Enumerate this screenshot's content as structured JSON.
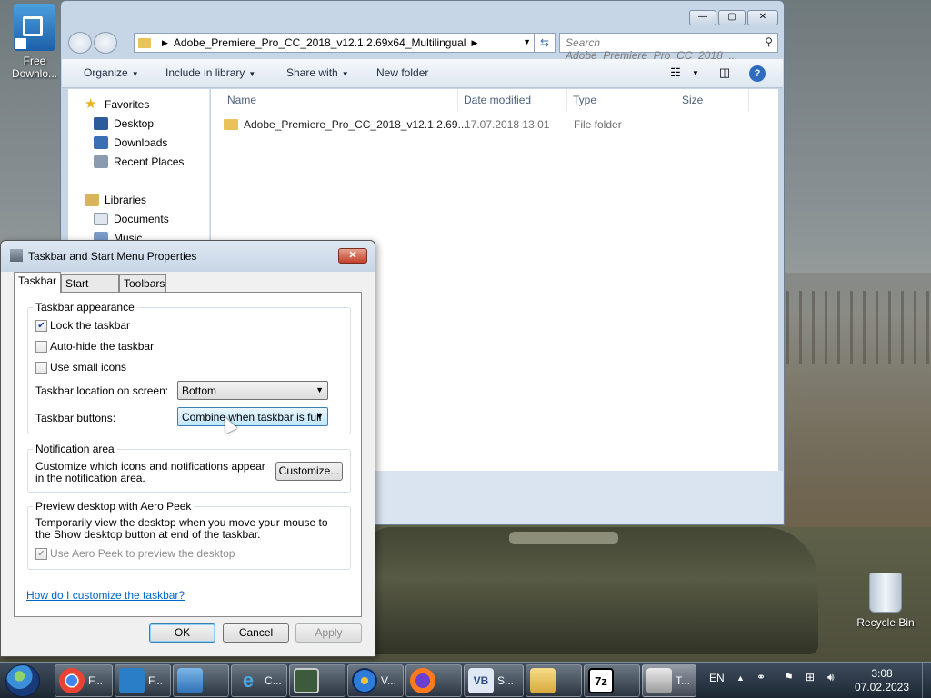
{
  "desktop": {
    "icons": [
      {
        "label": "Free Downlo..."
      },
      {
        "label": "Recycle Bin"
      }
    ]
  },
  "explorer": {
    "address_path": "Adobe_Premiere_Pro_CC_2018_v12.1.2.69x64_Multilingual",
    "search_placeholder": "Search Adobe_Premiere_Pro_CC_2018_...",
    "toolbar": {
      "organize": "Organize",
      "include_in_library": "Include in library",
      "share_with": "Share with",
      "new_folder": "New folder"
    },
    "nav": {
      "favorites": "Favorites",
      "desktop": "Desktop",
      "downloads": "Downloads",
      "recent_places": "Recent Places",
      "libraries": "Libraries",
      "documents": "Documents",
      "music": "Music"
    },
    "columns": {
      "name": "Name",
      "date_modified": "Date modified",
      "type": "Type",
      "size": "Size"
    },
    "files": [
      {
        "name": "Adobe_Premiere_Pro_CC_2018_v12.1.2.69...",
        "date": "17.07.2018 13:01",
        "type": "File folder"
      }
    ]
  },
  "dialog": {
    "title": "Taskbar and Start Menu Properties",
    "tabs": [
      "Taskbar",
      "Start Menu",
      "Toolbars"
    ],
    "appearance": {
      "group_title": "Taskbar appearance",
      "lock_taskbar": "Lock the taskbar",
      "auto_hide": "Auto-hide the taskbar",
      "small_icons": "Use small icons",
      "location_label": "Taskbar location on screen:",
      "location_value": "Bottom",
      "buttons_label": "Taskbar buttons:",
      "buttons_value": "Combine when taskbar is full"
    },
    "notification": {
      "group_title": "Notification area",
      "description": "Customize which icons and notifications appear in the notification area.",
      "customize_button": "Customize..."
    },
    "aero_peek": {
      "group_title": "Preview desktop with Aero Peek",
      "description": "Temporarily view the desktop when you move your mouse to the Show desktop button at end of the taskbar.",
      "checkbox": "Use Aero Peek to preview the desktop"
    },
    "help_link": "How do I customize the taskbar?",
    "buttons": {
      "ok": "OK",
      "cancel": "Cancel",
      "apply": "Apply"
    }
  },
  "taskbar": {
    "apps": [
      {
        "label": "F..."
      },
      {
        "label": "F..."
      },
      {
        "label": ""
      },
      {
        "label": "C..."
      },
      {
        "label": ""
      },
      {
        "label": "V..."
      },
      {
        "label": ""
      },
      {
        "label": "S..."
      },
      {
        "label": ""
      },
      {
        "label": "7z"
      },
      {
        "label": "T..."
      }
    ],
    "language": "EN",
    "time": "3:08",
    "date": "07.02.2023"
  }
}
